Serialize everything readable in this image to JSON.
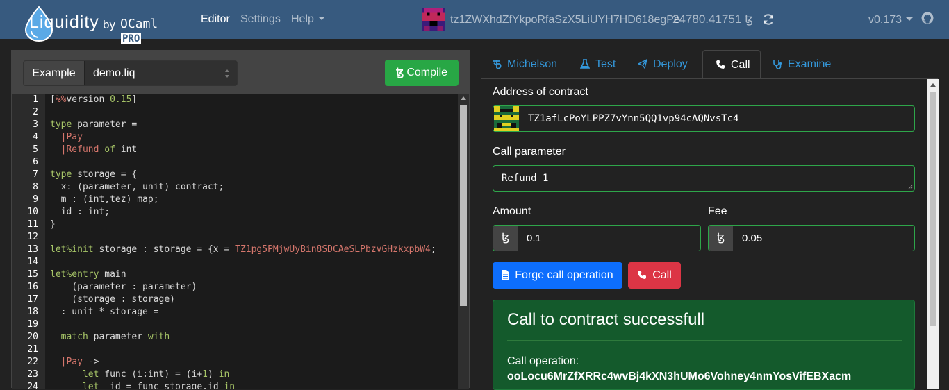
{
  "brand": {
    "logo_text": "Liquidity",
    "by": "by",
    "company": "OCaml",
    "company_badge": "PRO"
  },
  "nav": {
    "editor": "Editor",
    "settings": "Settings",
    "help": "Help",
    "account": "tz1ZWXhdZfYkpoRfaSzX5LiUYH7HD618egPe",
    "balance": "24780.41751 ꜩ",
    "version": "v0.173"
  },
  "toolbar": {
    "example_label": "Example",
    "example_selected": "demo.liq",
    "compile_label": "Compile",
    "tez_symbol": "ꜩ"
  },
  "code": [
    {
      "n": "1",
      "t": "[%%version 0.15]"
    },
    {
      "n": "2",
      "t": ""
    },
    {
      "n": "3",
      "t": "type parameter ="
    },
    {
      "n": "4",
      "t": "  |Pay"
    },
    {
      "n": "5",
      "t": "  |Refund of int"
    },
    {
      "n": "6",
      "t": ""
    },
    {
      "n": "7",
      "t": "type storage = {"
    },
    {
      "n": "8",
      "t": "  x: (parameter, unit) contract;"
    },
    {
      "n": "9",
      "t": "  m : (int,tez) map;"
    },
    {
      "n": "10",
      "t": "  id : int;"
    },
    {
      "n": "11",
      "t": "}"
    },
    {
      "n": "12",
      "t": ""
    },
    {
      "n": "13",
      "t": "let%init storage : storage = {x = TZ1pg5PMjwUyBin8SDCAeSLPbzvGHzkxpbW4;"
    },
    {
      "n": "14",
      "t": ""
    },
    {
      "n": "15",
      "t": "let%entry main"
    },
    {
      "n": "16",
      "t": "    (parameter : parameter)"
    },
    {
      "n": "17",
      "t": "    (storage : storage)"
    },
    {
      "n": "18",
      "t": "  : unit * storage ="
    },
    {
      "n": "19",
      "t": ""
    },
    {
      "n": "20",
      "t": "  match parameter with"
    },
    {
      "n": "21",
      "t": ""
    },
    {
      "n": "22",
      "t": "  |Pay ->"
    },
    {
      "n": "23",
      "t": "      let func (i:int) = (i+1) in"
    },
    {
      "n": "24",
      "t": "      let _id = func storage.id in"
    }
  ],
  "tabs": [
    {
      "label": "Michelson",
      "icon": "tezos-icon"
    },
    {
      "label": "Test",
      "icon": "flask-icon"
    },
    {
      "label": "Deploy",
      "icon": "paper-plane-icon"
    },
    {
      "label": "Call",
      "icon": "phone-icon"
    },
    {
      "label": "Examine",
      "icon": "stethoscope-icon"
    }
  ],
  "call": {
    "address_label": "Address of contract",
    "address_value": "TZ1afLcPoYLPPZ7vYnn5QQ1vp94cAQNvsTc4",
    "param_label": "Call parameter",
    "param_value": "Refund 1",
    "amount_label": "Amount",
    "amount_value": "0.1",
    "fee_label": "Fee",
    "fee_value": "0.05",
    "tez_symbol": "ꜩ",
    "forge_label": "Forge call operation",
    "call_label": "Call"
  },
  "result": {
    "title": "Call to contract successfull",
    "op_label": "Call operation:",
    "op_value": "ooLocu6MrZfXRRc4wvBj4kXN3hUMo6Vohney4nmYosVifEBXacm"
  },
  "colors": {
    "navbar": "#375a7f",
    "success": "#28a745",
    "primary": "#0d6efd",
    "danger": "#dc3545",
    "link": "#3498db"
  }
}
